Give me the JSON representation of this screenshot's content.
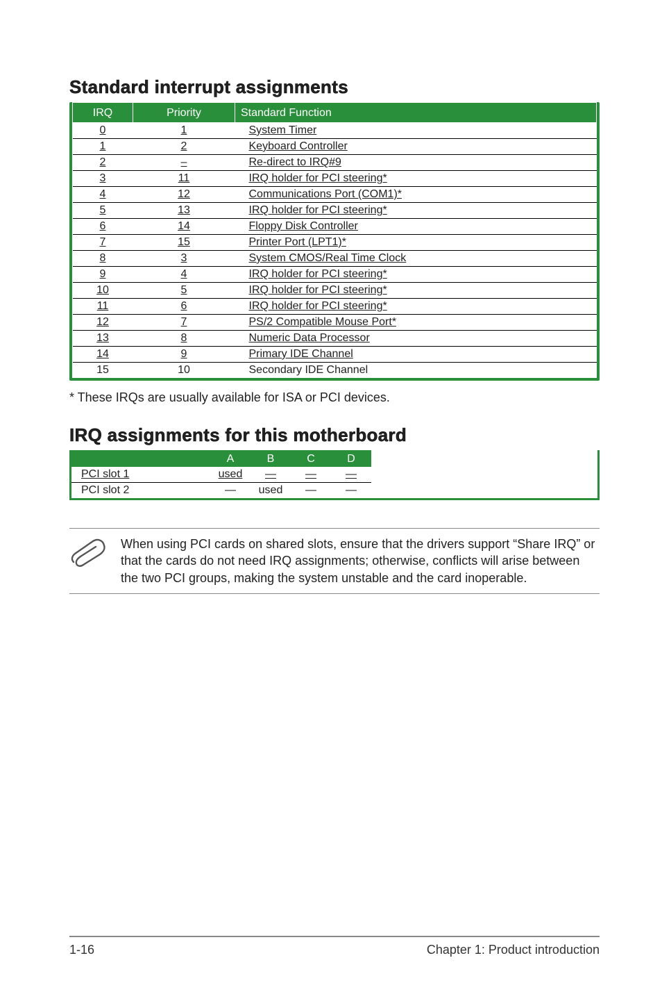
{
  "heading1": "Standard interrupt assignments",
  "table1": {
    "headers": {
      "irq": "IRQ",
      "priority": "Priority",
      "func": "Standard Function"
    },
    "rows": [
      {
        "irq": "0",
        "priority": "1",
        "func": "System Timer"
      },
      {
        "irq": "1",
        "priority": "2",
        "func": "Keyboard Controller"
      },
      {
        "irq": "2",
        "priority": "–",
        "func": "Re-direct to IRQ#9"
      },
      {
        "irq": "3",
        "priority": "11",
        "func": "IRQ holder for PCI steering*"
      },
      {
        "irq": "4",
        "priority": "12",
        "func": "Communications Port (COM1)*"
      },
      {
        "irq": "5",
        "priority": "13",
        "func": "IRQ holder for PCI steering*"
      },
      {
        "irq": "6",
        "priority": "14",
        "func": "Floppy Disk Controller"
      },
      {
        "irq": "7",
        "priority": "15",
        "func": "Printer Port (LPT1)*"
      },
      {
        "irq": "8",
        "priority": "3",
        "func": "System CMOS/Real Time Clock"
      },
      {
        "irq": "9",
        "priority": "4",
        "func": "IRQ holder for PCI steering*"
      },
      {
        "irq": "10",
        "priority": "5",
        "func": "IRQ holder for PCI steering*"
      },
      {
        "irq": "11",
        "priority": "6",
        "func": "IRQ holder for PCI steering*"
      },
      {
        "irq": "12",
        "priority": "7",
        "func": "PS/2 Compatible Mouse Port*"
      },
      {
        "irq": "13",
        "priority": "8",
        "func": "Numeric Data Processor"
      },
      {
        "irq": "14",
        "priority": "9",
        "func": "Primary IDE Channel"
      },
      {
        "irq": "15",
        "priority": "10",
        "func": "Secondary IDE Channel"
      }
    ]
  },
  "footnote": "* These IRQs are usually available for ISA or PCI devices.",
  "heading2": "IRQ assignments for this motherboard",
  "table2": {
    "cols": [
      "A",
      "B",
      "C",
      "D"
    ],
    "rows": [
      {
        "label": "PCI slot 1",
        "vals": [
          "used",
          "—",
          "—",
          "—"
        ]
      },
      {
        "label": "PCI slot 2",
        "vals": [
          "—",
          "used",
          "—",
          "—"
        ]
      }
    ]
  },
  "callout_text": "When using PCI cards on shared slots, ensure that the drivers support “Share IRQ” or that the cards do not need IRQ assignments; otherwise, conflicts will arise between the two PCI groups, making the system unstable and the card inoperable.",
  "footer": {
    "left": "1-16",
    "right": "Chapter 1: Product introduction"
  }
}
